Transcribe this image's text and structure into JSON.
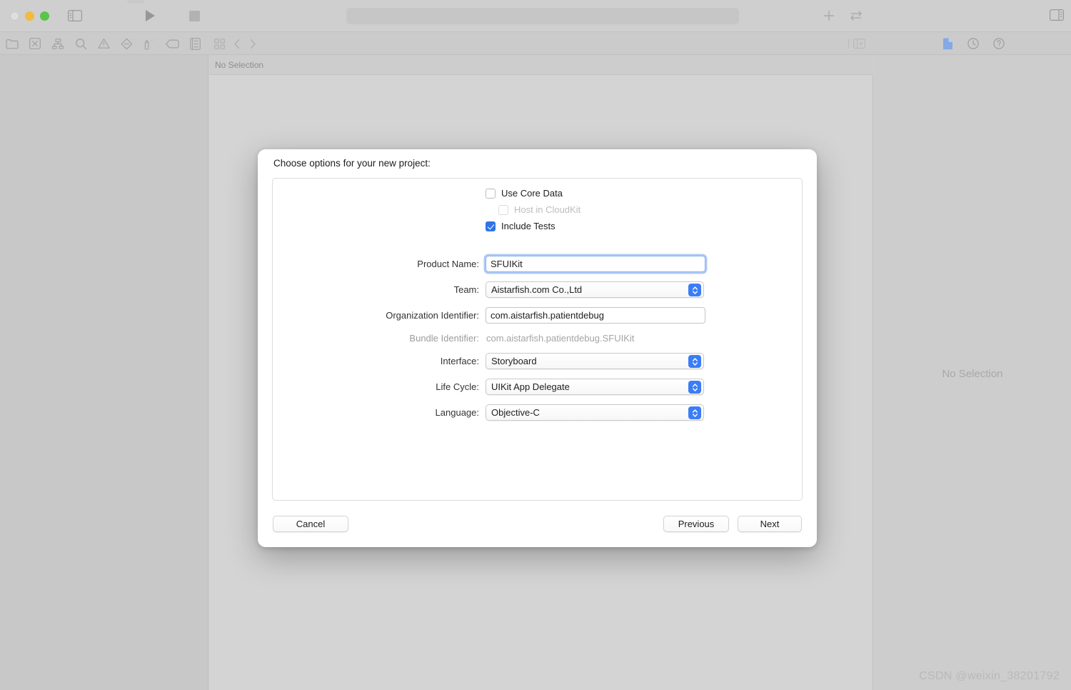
{
  "window": {
    "traffic_lights": [
      "close",
      "minimize",
      "maximize"
    ],
    "activity_field_value": ""
  },
  "toolbar": {
    "sidebar_toggle_icon": "sidebar-toggle-icon",
    "run_icon": "play-icon",
    "stop_icon": "stop-icon",
    "add_icon": "plus-icon",
    "swap_icon": "swap-arrows-icon",
    "inspector_toggle_icon": "inspector-toggle-icon"
  },
  "navigator_toolbar": {
    "icons": [
      "folder-icon",
      "source-control-icon",
      "symbol-hierarchy-icon",
      "search-icon",
      "warning-triangle-icon",
      "breakpoint-diamond-icon",
      "debug-spray-icon",
      "tag-icon",
      "report-list-icon"
    ]
  },
  "jumpbar": {
    "grid_icon": "grid-icon",
    "back_icon": "chevron-left-icon",
    "forward_icon": "chevron-right-icon"
  },
  "editor": {
    "header_label": "No Selection",
    "split_icon": "add-editor-icon"
  },
  "inspector": {
    "icons": [
      "file-inspector-icon",
      "history-inspector-icon",
      "quick-help-icon"
    ],
    "empty_label": "No Selection"
  },
  "watermark": {
    "text": "CSDN @weixin_38201792"
  },
  "dialog": {
    "title": "Choose options for your new project:",
    "fields": [
      {
        "label": "Product Name:",
        "type": "text",
        "value": "SFUIKit",
        "focused": true
      },
      {
        "label": "Team:",
        "type": "popup",
        "value": "Aistarfish.com Co.,Ltd"
      },
      {
        "label": "Organization Identifier:",
        "type": "text",
        "value": "com.aistarfish.patientdebug",
        "focused": false
      },
      {
        "label": "Bundle Identifier:",
        "type": "static",
        "value": "com.aistarfish.patientdebug.SFUIKit"
      },
      {
        "label": "Interface:",
        "type": "popup",
        "value": "Storyboard"
      },
      {
        "label": "Life Cycle:",
        "type": "popup",
        "value": "UIKit App Delegate"
      },
      {
        "label": "Language:",
        "type": "popup",
        "value": "Objective-C"
      }
    ],
    "checkboxes": [
      {
        "label": "Use Core Data",
        "checked": false,
        "disabled": false,
        "indent": false
      },
      {
        "label": "Host in CloudKit",
        "checked": false,
        "disabled": true,
        "indent": true
      },
      {
        "label": "Include Tests",
        "checked": true,
        "disabled": false,
        "indent": false
      }
    ],
    "buttons": {
      "cancel": "Cancel",
      "previous": "Previous",
      "next": "Next"
    },
    "accent_color": "#2f74e8",
    "focus_ring_color": "#6ea0f0"
  }
}
